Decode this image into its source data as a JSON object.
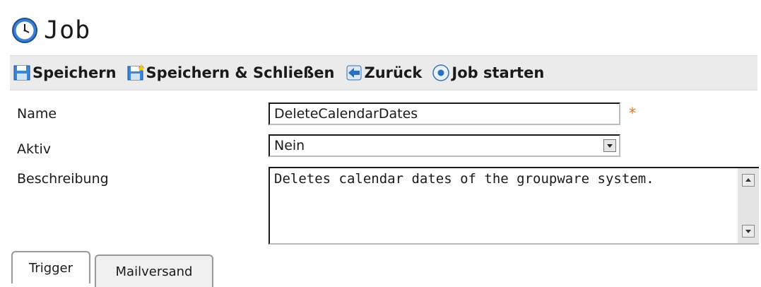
{
  "header": {
    "title": "Job",
    "icon": "clock-icon"
  },
  "toolbar": {
    "save_label": "Speichern",
    "save_close_label": "Speichern & Schließen",
    "back_label": "Zurück",
    "start_label": "Job starten"
  },
  "form": {
    "name_label": "Name",
    "name_value": "DeleteCalendarDates",
    "required_marker": "*",
    "active_label": "Aktiv",
    "active_value": "Nein",
    "description_label": "Beschreibung",
    "description_value": "Deletes calendar dates of the groupware system."
  },
  "tabs": [
    {
      "label": "Trigger",
      "active": true
    },
    {
      "label": "Mailversand",
      "active": false
    }
  ],
  "colors": {
    "toolbar_bg": "#ebebeb",
    "required": "#e8701a",
    "icon_blue": "#2a6fc0"
  }
}
